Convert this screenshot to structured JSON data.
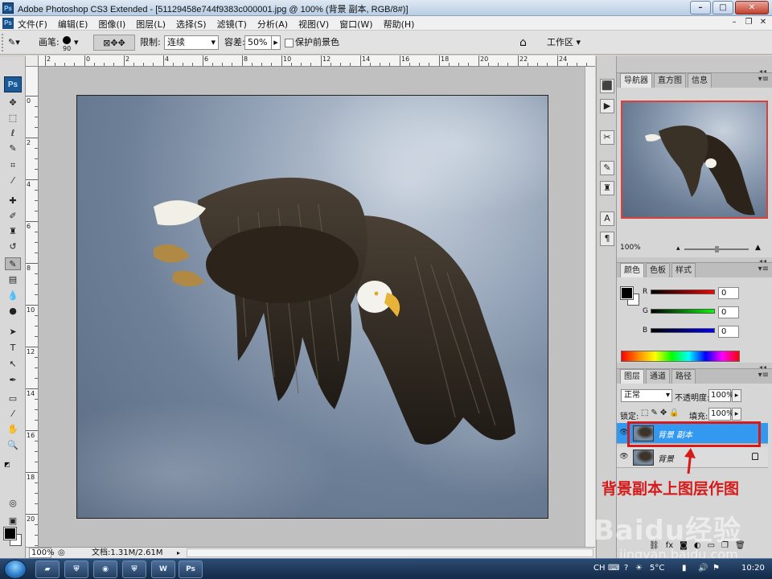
{
  "window": {
    "title": "Adobe Photoshop CS3 Extended - [51129458e744f9383c000001.jpg @ 100% (背景 副本, RGB/8#)]",
    "app_icon": "Ps"
  },
  "menu": {
    "app_icon": "Ps",
    "items": [
      "文件(F)",
      "编辑(E)",
      "图像(I)",
      "图层(L)",
      "选择(S)",
      "滤镜(T)",
      "分析(A)",
      "视图(V)",
      "窗口(W)",
      "帮助(H)"
    ]
  },
  "options": {
    "brush_label": "画笔:",
    "brush_size": "90",
    "limit_label": "限制:",
    "limit_value": "连续",
    "tolerance_label": "容差:",
    "tolerance_value": "50%",
    "protect_fg_label": "保护前景色",
    "workspace_label": "工作区",
    "workspace_arrow": "▾"
  },
  "ruler_h": [
    "2",
    "0",
    "2",
    "4",
    "6",
    "8",
    "10",
    "12",
    "14",
    "16",
    "18",
    "20",
    "22",
    "24",
    "26"
  ],
  "ruler_v": [
    "0",
    "2",
    "4",
    "6",
    "8",
    "10",
    "12",
    "14",
    "16",
    "18",
    "20"
  ],
  "status": {
    "zoom": "100%",
    "doc": "文档:1.31M/2.61M"
  },
  "tools": {
    "logo": "Ps",
    "icons": [
      "move-icon",
      "marquee-icon",
      "lasso-icon",
      "quick-select-icon",
      "crop-icon",
      "eyedropper-icon",
      "healing-icon",
      "brush-icon",
      "clone-stamp-icon",
      "history-brush-icon",
      "background-eraser-icon",
      "gradient-icon",
      "blur-icon",
      "dodge-icon",
      "path-select-icon",
      "type-icon",
      "direct-select-icon",
      "pen-icon",
      "notes-icon",
      "eyedropper2-icon",
      "hand-icon",
      "zoom-icon"
    ]
  },
  "navigator": {
    "tabs": [
      "导航器",
      "直方图",
      "信息"
    ],
    "zoom": "100%"
  },
  "color_panel": {
    "tabs": [
      "颜色",
      "色板",
      "样式"
    ],
    "channels": [
      {
        "label": "R",
        "value": "0",
        "color": "#cc0000"
      },
      {
        "label": "G",
        "value": "0",
        "color": "#00aa00"
      },
      {
        "label": "B",
        "value": "0",
        "color": "#0000cc"
      }
    ]
  },
  "layers_panel": {
    "tabs": [
      "图层",
      "通道",
      "路径"
    ],
    "blend_mode": "正常",
    "opacity_label": "不透明度:",
    "opacity_value": "100%",
    "lock_label": "锁定:",
    "fill_label": "填充:",
    "fill_value": "100%",
    "layers": [
      {
        "name": "背景 副本",
        "selected": true,
        "locked": false
      },
      {
        "name": "背景",
        "selected": false,
        "locked": true
      }
    ],
    "bottom_icons": [
      "link-icon",
      "fx-icon",
      "mask-icon",
      "adjustment-icon",
      "group-icon",
      "new-layer-icon",
      "delete-icon"
    ]
  },
  "annotation": {
    "text": "背景副本上图层作图",
    "color": "#d61a1a"
  },
  "watermark": {
    "text": "Baidu经验",
    "sub": "jingyan.baidu.com"
  },
  "taskbar": {
    "buttons": [
      "folder-icon",
      "shield-icon",
      "globe-icon",
      "shield-icon",
      "word-icon",
      "photoshop-icon"
    ],
    "tray": {
      "lang": "CH",
      "temp": "5°C",
      "time": "10:20"
    }
  }
}
